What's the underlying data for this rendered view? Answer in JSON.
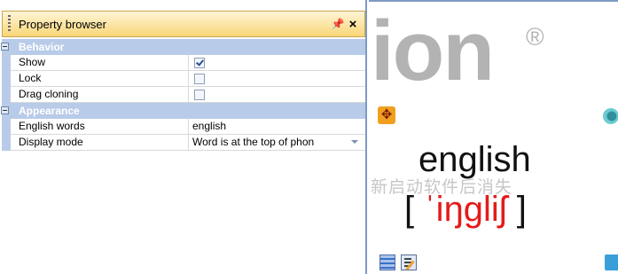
{
  "property_browser": {
    "title": "Property browser",
    "pin_glyph": "ᵘ",
    "close_glyph": "×",
    "categories": [
      {
        "label": "Behavior",
        "properties": [
          {
            "name": "Show",
            "type": "checkbox",
            "checked": true
          },
          {
            "name": "Lock",
            "type": "checkbox",
            "checked": false
          },
          {
            "name": "Drag cloning",
            "type": "checkbox",
            "checked": false
          }
        ]
      },
      {
        "label": "Appearance",
        "properties": [
          {
            "name": "English words",
            "type": "text",
            "value": "english"
          },
          {
            "name": "Display mode",
            "type": "dropdown",
            "value": "Word is at the top of phon"
          }
        ]
      }
    ]
  },
  "preview": {
    "logo_text": "ion",
    "registered_mark": "®",
    "word": "english",
    "watermark": "新启动软件后消失",
    "phonetic_open": "[",
    "phonetic_ipa": "ˈiŋgliʃ",
    "phonetic_close": "]",
    "icons": [
      "move-icon",
      "refresh-icon",
      "list-icon",
      "edit-icon",
      "rotate-icon"
    ]
  },
  "colors": {
    "title_bar": "#f8d778",
    "category_band": "#b8cbe8",
    "phonetic_accent": "#e41b1b",
    "panel_border": "#7c9ac4"
  }
}
